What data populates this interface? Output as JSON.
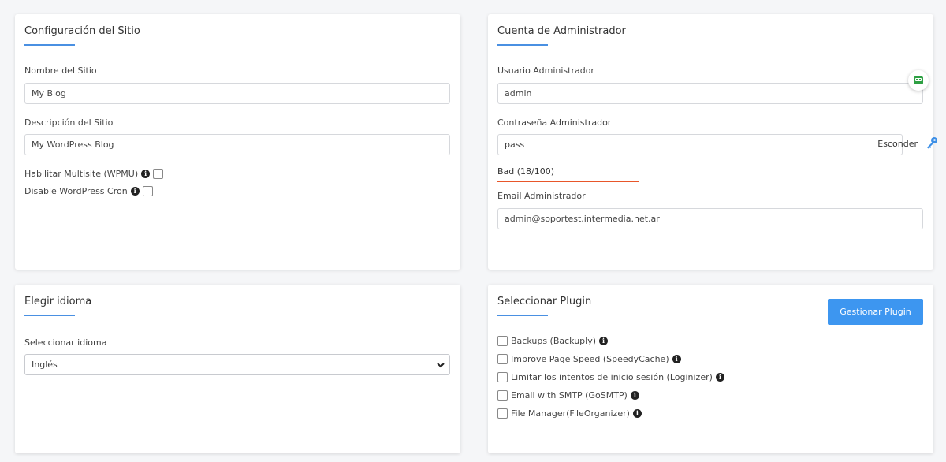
{
  "site_config": {
    "title": "Configuración del Sitio",
    "site_name_label": "Nombre del Sitio",
    "site_name_value": "My Blog",
    "site_desc_label": "Descripción del Sitio",
    "site_desc_value": "My WordPress Blog",
    "multisite_label": "Habilitar Multisite (WPMU)",
    "cron_label": "Disable WordPress Cron"
  },
  "admin_account": {
    "title": "Cuenta de Administrador",
    "user_label": "Usuario Administrador",
    "user_value": "admin",
    "pass_label": "Contraseña Administrador",
    "pass_value": "pass",
    "pass_toggle": "Esconder",
    "strength_text": "Bad (18/100)",
    "email_label": "Email Administrador",
    "email_value": "admin@soportest.intermedia.net.ar"
  },
  "language": {
    "title": "Elegir idioma",
    "select_label": "Seleccionar idioma",
    "selected": "Inglés"
  },
  "plugins": {
    "title": "Seleccionar Plugin",
    "manage_button": "Gestionar Plugin",
    "items": [
      {
        "label": "Backups (Backuply)"
      },
      {
        "label": "Improve Page Speed (SpeedyCache)"
      },
      {
        "label": "Limitar los intentos de inicio sesión (Loginizer)"
      },
      {
        "label": "Email with SMTP (GoSMTP)"
      },
      {
        "label": "File Manager(FileOrganizer)"
      }
    ]
  },
  "colors": {
    "accent": "#4a90e2",
    "button": "#3d96f0",
    "strength_bad": "#e8562a"
  }
}
